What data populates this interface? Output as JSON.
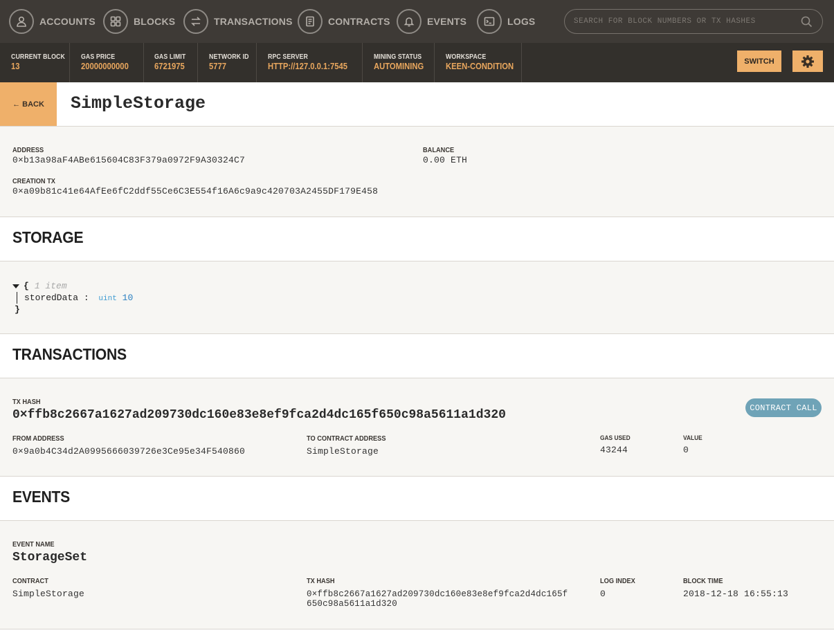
{
  "nav": {
    "items": [
      {
        "label": "ACCOUNTS",
        "icon": "account-icon"
      },
      {
        "label": "BLOCKS",
        "icon": "blocks-icon"
      },
      {
        "label": "TRANSACTIONS",
        "icon": "transactions-icon"
      },
      {
        "label": "CONTRACTS",
        "icon": "contracts-icon"
      },
      {
        "label": "EVENTS",
        "icon": "bell-icon"
      },
      {
        "label": "LOGS",
        "icon": "terminal-icon"
      }
    ],
    "search_placeholder": "SEARCH FOR BLOCK NUMBERS OR TX HASHES"
  },
  "status": {
    "current_block_label": "CURRENT BLOCK",
    "current_block": "13",
    "gas_price_label": "GAS PRICE",
    "gas_price": "20000000000",
    "gas_limit_label": "GAS LIMIT",
    "gas_limit": "6721975",
    "network_id_label": "NETWORK ID",
    "network_id": "5777",
    "rpc_server_label": "RPC SERVER",
    "rpc_server": "HTTP://127.0.0.1:7545",
    "mining_status_label": "MINING STATUS",
    "mining_status": "AUTOMINING",
    "workspace_label": "WORKSPACE",
    "workspace": "KEEN-CONDITION",
    "switch_label": "SWITCH"
  },
  "title": {
    "back_label": "← BACK",
    "contract_name": "SimpleStorage"
  },
  "contract": {
    "address_label": "ADDRESS",
    "address": "0×b13a98aF4ABe615604C83F379a0972F9A30324C7",
    "balance_label": "BALANCE",
    "balance": "0.00 ETH",
    "creation_tx_label": "CREATION TX",
    "creation_tx": "0×a09b81c41e64AfEe6fC2ddf55Ce6C3E554f16A6c9a9c420703A2455DF179E458"
  },
  "storage": {
    "heading": "STORAGE",
    "open_brace": "{",
    "close_brace": "}",
    "item_count": "1 item",
    "key": "storedData",
    "type": "uint",
    "value": "10"
  },
  "transactions": {
    "heading": "TRANSACTIONS",
    "tx_hash_label": "TX HASH",
    "tx_hash": "0×ffb8c2667a1627ad209730dc160e83e8ef9fca2d4dc165f650c98a5611a1d320",
    "badge": "CONTRACT CALL",
    "from_label": "FROM ADDRESS",
    "from": "0×9a0b4C34d2A0995666039726e3Ce95e34F540860",
    "to_label": "TO CONTRACT ADDRESS",
    "to": "SimpleStorage",
    "gas_used_label": "GAS USED",
    "gas_used": "43244",
    "value_label": "VALUE",
    "value": "0"
  },
  "events": {
    "heading": "EVENTS",
    "event_name_label": "EVENT NAME",
    "event_name": "StorageSet",
    "contract_label": "CONTRACT",
    "contract": "SimpleStorage",
    "tx_hash_label": "TX HASH",
    "tx_hash_line1": "0×ffb8c2667a1627ad209730dc160e83e8ef9fca2d4dc165f",
    "tx_hash_line2": "650c98a5611a1d320",
    "log_index_label": "LOG INDEX",
    "log_index": "0",
    "block_time_label": "BLOCK TIME",
    "block_time": "2018-12-18 16:55:13"
  },
  "colors": {
    "nav_bg": "#3e3a36",
    "status_bg": "#33302c",
    "accent": "#efb06a",
    "status_value": "#e9a75e",
    "badge": "#6fa3b7"
  }
}
